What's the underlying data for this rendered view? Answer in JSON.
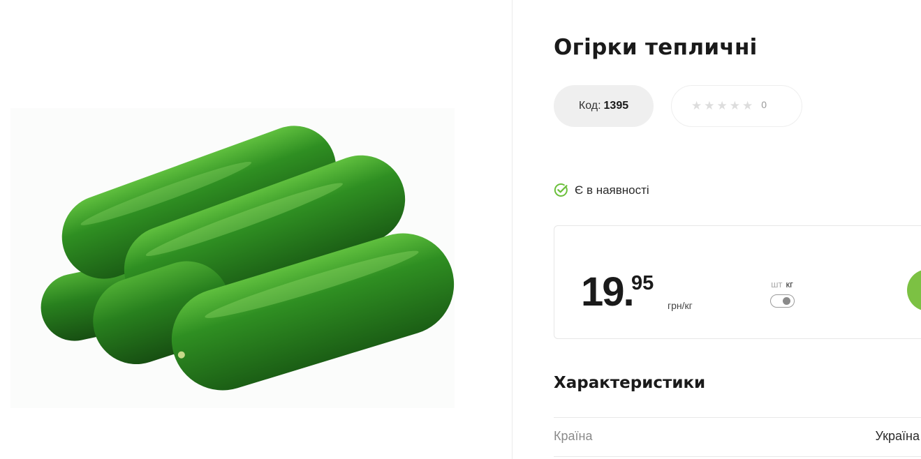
{
  "product": {
    "title": "Огірки тепличні",
    "code_label": "Код:",
    "code_value": "1395",
    "rating": {
      "stars_filled": 0,
      "stars_total": 5,
      "count": "0"
    },
    "stock_status": "Є в наявності",
    "image_alt": "cucumbers"
  },
  "price": {
    "whole": "19.",
    "cents": "95",
    "unit": "грн/кг",
    "unit_options": {
      "piece": "шт",
      "kg": "кг"
    },
    "selected_unit": "кг"
  },
  "characteristics": {
    "title": "Характеристики",
    "rows": [
      {
        "label": "Країна",
        "value": "Україна"
      }
    ]
  },
  "colors": {
    "accent_green": "#7cc143",
    "check_green": "#6abf3a",
    "cucumber_green": "#2f8a22",
    "pill_bg": "#efefef"
  },
  "icons": {
    "stock": "check-circle-icon",
    "star": "star-icon"
  }
}
